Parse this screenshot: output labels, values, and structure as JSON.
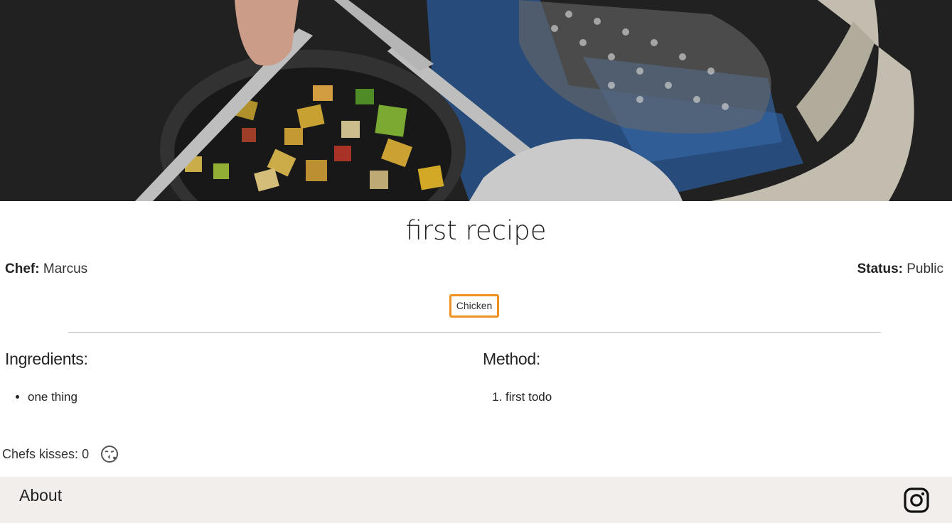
{
  "recipe": {
    "title": "first recipe",
    "chef_label": "Chef:",
    "chef_name": "Marcus",
    "status_label": "Status:",
    "status_value": "Public",
    "tag": "Chicken"
  },
  "ingredients": {
    "heading": "Ingredients:",
    "items": [
      "one thing"
    ]
  },
  "method": {
    "heading": "Method:",
    "steps": [
      "first todo"
    ]
  },
  "kisses": {
    "label": "Chefs kisses:",
    "count": "0",
    "icon": "kiss-face-icon"
  },
  "footer": {
    "about_label": "About",
    "social_icon": "instagram-icon"
  },
  "colors": {
    "tag_border": "#f0901f",
    "footer_bg": "#f1eeec",
    "hero_bg": "#2a2a2a"
  }
}
